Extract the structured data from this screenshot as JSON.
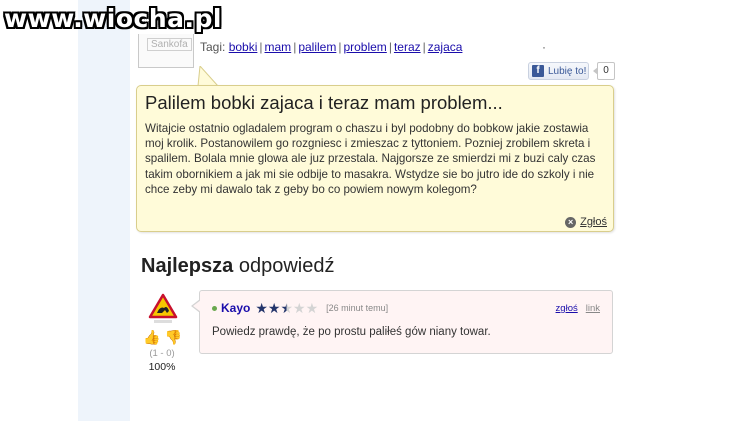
{
  "watermark": "www.wiocha.pl",
  "top": {
    "avatar_text": "Sankofa",
    "tags_lead": "Tagi:",
    "tags": [
      "bobki",
      "mam",
      "palilem",
      "problem",
      "teraz",
      "zajaca"
    ],
    "separator": "|",
    "dot": "·",
    "like_label": "Lubię to!",
    "like_icon_letter": "f",
    "like_count": "0"
  },
  "question": {
    "title": "Palilem bobki zajaca i teraz mam problem...",
    "body": "Witajcie ostatnio ogladalem program o chaszu i byl podobny do bobkow jakie zostawia moj krolik. Postanowilem go rozgniesc i zmieszac z tyttoniem. Pozniej zrobilem skreta i spalilem. Bolala mnie glowa ale juz przestala. Najgorsze ze smierdzi mi z buzi caly czas takim obornikiem a jak mi sie odbije to masakra. Wstydze sie bo jutro ide do szkoly i nie chce zeby mi dawalo tak z geby bo co powiem nowym kolegom?",
    "report_label": "Zgłoś",
    "report_icon": "×"
  },
  "best_answer": {
    "heading_bold": "Najlepsza",
    "heading_rest": " odpowiedź",
    "votes": {
      "up_icon": "👍",
      "down_icon": "👎",
      "stats": "(1 - 0)",
      "percent": "100%"
    },
    "user": "Kayo",
    "rating_stars": 2.5,
    "rating_max": 5,
    "time": "[26 minut temu]",
    "report_link": "zgłoś",
    "permalink": "link",
    "text": "Powiedz prawdę, że po prostu paliłeś gów niany towar."
  },
  "colors": {
    "question_bg": "#fffbd9",
    "answer_bg": "#fff4f4",
    "link": "#1a0dab",
    "star": "#24356b"
  }
}
